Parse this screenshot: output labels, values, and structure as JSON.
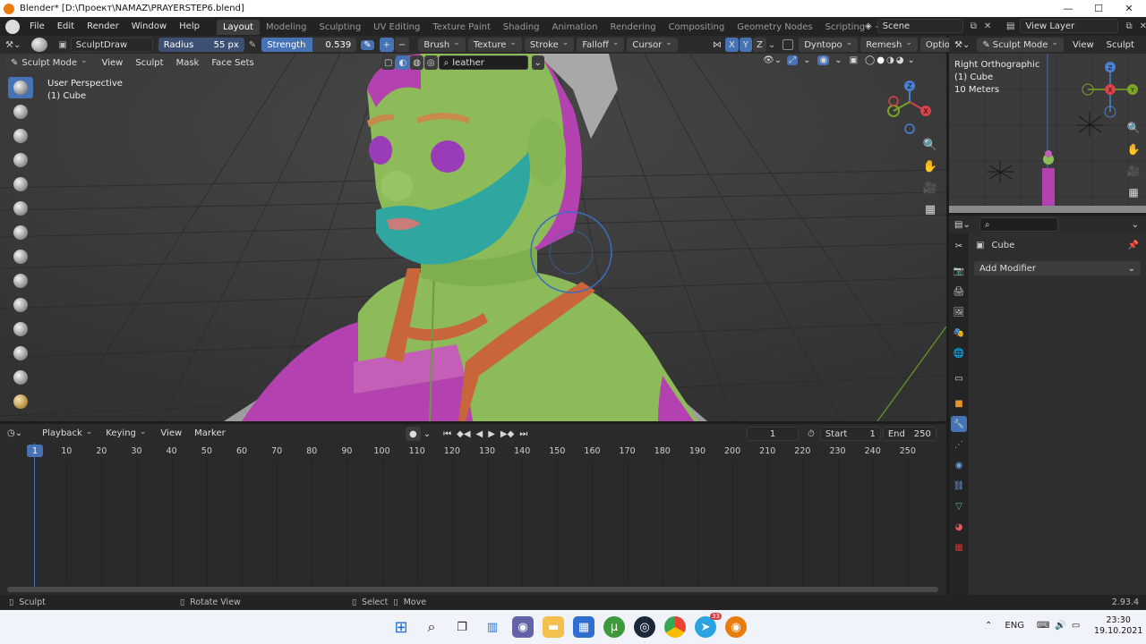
{
  "titlebar": {
    "title": "Blender* [D:\\Проект\\NAMAZ\\PRAYERSTEP6.blend]",
    "minimize": "—",
    "maximize": "☐",
    "close": "✕"
  },
  "menus": [
    "File",
    "Edit",
    "Render",
    "Window",
    "Help"
  ],
  "workspaces": [
    "Layout",
    "Modeling",
    "Sculpting",
    "UV Editing",
    "Texture Paint",
    "Shading",
    "Animation",
    "Rendering",
    "Compositing",
    "Geometry Nodes",
    "Scripting"
  ],
  "active_workspace": "Layout",
  "scene": {
    "label": "Scene",
    "view_layer": "View Layer"
  },
  "tool_header": {
    "brush_name": "SculptDraw",
    "radius_label": "Radius",
    "radius_value": "55 px",
    "strength_label": "Strength",
    "strength_value": "0.539",
    "brush": "Brush",
    "texture": "Texture",
    "stroke": "Stroke",
    "falloff": "Falloff",
    "cursor": "Cursor",
    "axis": [
      "X",
      "Y",
      "Z"
    ],
    "dyntopo": "Dyntopo",
    "remesh": "Remesh",
    "options": "Options"
  },
  "viewport_header": {
    "mode": "Sculpt Mode",
    "menus": [
      "View",
      "Sculpt",
      "Mask",
      "Face Sets"
    ],
    "search": "leather"
  },
  "viewport_info": {
    "line1": "User Perspective",
    "line2": "(1) Cube"
  },
  "right_viewport": {
    "mode": "Sculpt Mode",
    "menus": [
      "View",
      "Sculpt"
    ],
    "line1": "Right Orthographic",
    "line2": "(1) Cube",
    "line3": "10 Meters"
  },
  "timeline": {
    "menus": [
      "Playback",
      "Keying",
      "View",
      "Marker"
    ],
    "current_frame": "1",
    "start_label": "Start",
    "start": "1",
    "end_label": "End",
    "end": "250",
    "ticks": [
      "1",
      "10",
      "20",
      "30",
      "40",
      "50",
      "60",
      "70",
      "80",
      "90",
      "100",
      "110",
      "120",
      "130",
      "140",
      "150",
      "160",
      "170",
      "180",
      "190",
      "200",
      "210",
      "220",
      "230",
      "240",
      "250"
    ]
  },
  "properties": {
    "object": "Cube",
    "add_modifier": "Add Modifier"
  },
  "statusbar": {
    "sculpt": "Sculpt",
    "rotate": "Rotate View",
    "select": "Select",
    "move": "Move",
    "version": "2.93.4"
  },
  "taskbar": {
    "lang": "ENG",
    "time": "23:30",
    "date": "19.10.2021",
    "badge": "33"
  },
  "colors": {
    "accent": "#4772b3",
    "skin": "#8dbb5a",
    "hair": "#b341b0",
    "beard": "#2fa7a0",
    "stripe": "#c8653a"
  }
}
